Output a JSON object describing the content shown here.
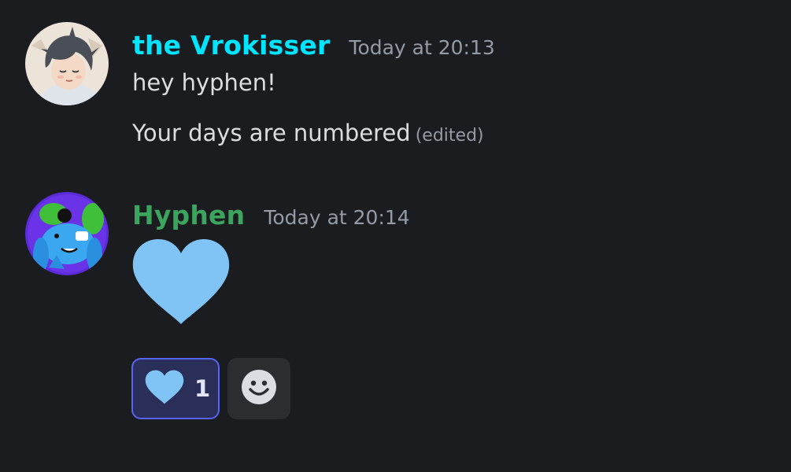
{
  "messages": [
    {
      "author": "the Vrokisser",
      "author_color": "#00e5ff",
      "timestamp": "Today at 20:13",
      "lines": [
        {
          "text": "hey hyphen!"
        },
        {
          "text": "Your days are numbered",
          "edited_label": "(edited)"
        }
      ],
      "avatar_icon": "anime-character-avatar"
    },
    {
      "author": "Hyphen",
      "author_color": "#3ba55d",
      "timestamp": "Today at 20:14",
      "jumbo_emoji_icon": "blue-heart-icon",
      "avatar_icon": "cartoon-creature-avatar",
      "reactions": [
        {
          "emoji_icon": "blue-heart-icon",
          "count": "1",
          "selected": true
        }
      ],
      "add_reaction_icon": "smiley-face-icon"
    }
  ],
  "colors": {
    "background": "#1b1c20",
    "heart": "#7fc4f5",
    "reaction_selected_bg": "#2a2f5a",
    "reaction_selected_border": "#5865f2",
    "timestamp": "#949ba4"
  }
}
